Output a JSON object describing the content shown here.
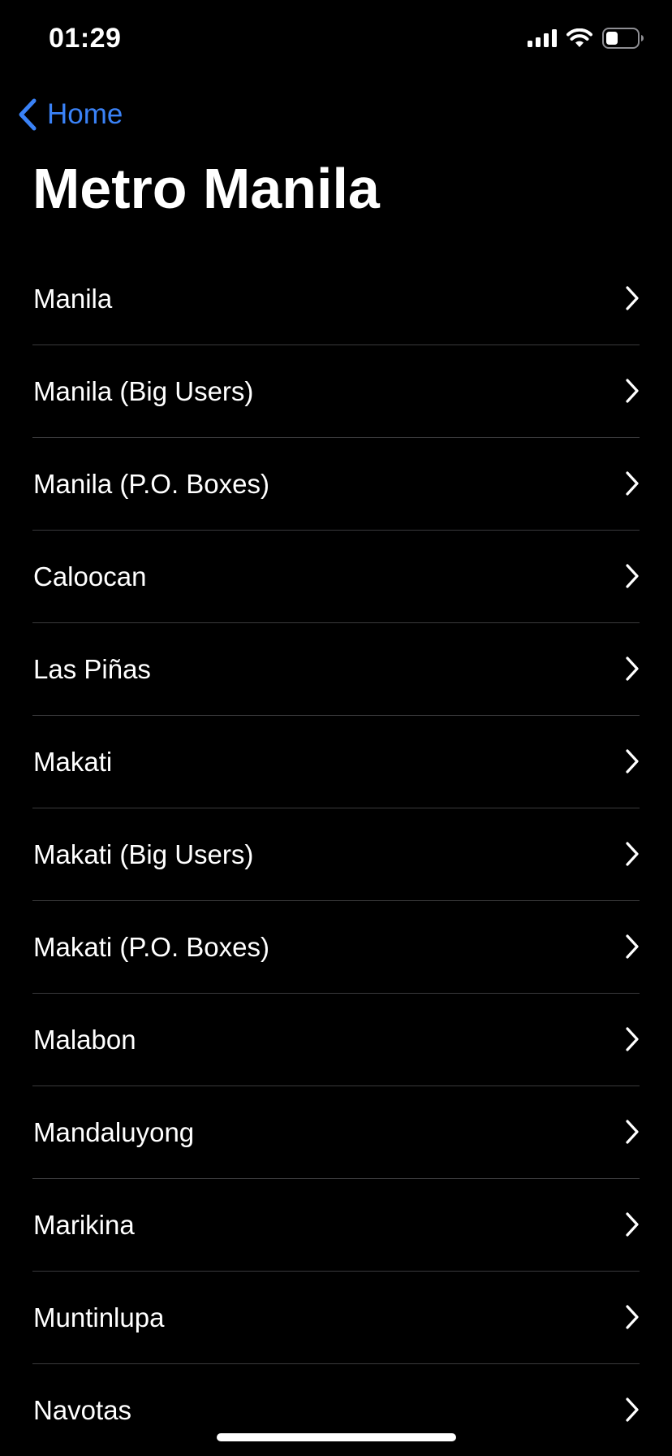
{
  "status_bar": {
    "time": "01:29",
    "icons": [
      "cellular-signal-icon",
      "wifi-icon",
      "battery-icon"
    ]
  },
  "nav": {
    "back_label": "Home",
    "back_icon": "chevron-left-icon",
    "accent_color": "#3a82f7"
  },
  "page": {
    "title": "Metro Manila"
  },
  "list": {
    "items": [
      {
        "label": "Manila"
      },
      {
        "label": "Manila (Big Users)"
      },
      {
        "label": "Manila (P.O. Boxes)"
      },
      {
        "label": "Caloocan"
      },
      {
        "label": "Las Piñas"
      },
      {
        "label": "Makati"
      },
      {
        "label": "Makati (Big Users)"
      },
      {
        "label": "Makati (P.O. Boxes)"
      },
      {
        "label": "Malabon"
      },
      {
        "label": "Mandaluyong"
      },
      {
        "label": "Marikina"
      },
      {
        "label": "Muntinlupa"
      },
      {
        "label": "Navotas"
      }
    ],
    "item_icon": "chevron-right-icon"
  },
  "colors": {
    "background": "#000000",
    "text": "#ffffff",
    "separator": "#3a3a3c"
  }
}
